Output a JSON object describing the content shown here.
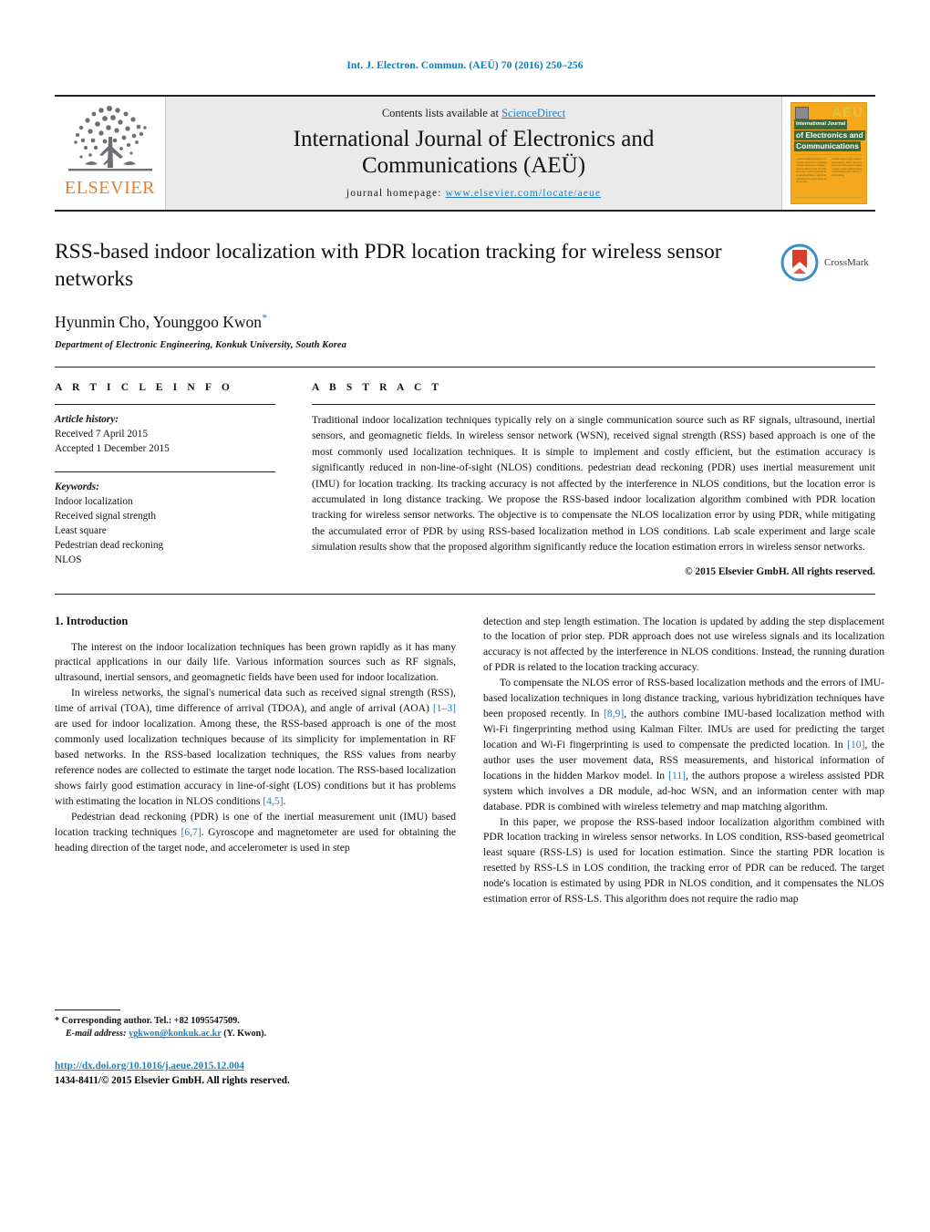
{
  "running_head": "Int. J. Electron. Commun. (AEÜ) 70 (2016) 250–256",
  "masthead": {
    "publisher_name": "ELSEVIER",
    "contents_prefix": "Contents lists available at ",
    "contents_link": "ScienceDirect",
    "journal_title_line1": "International Journal of Electronics and",
    "journal_title_line2": "Communications (AEÜ)",
    "homepage_label": "journal homepage:",
    "homepage_url": "www.elsevier.com/locate/aeue",
    "cover": {
      "badge": "AEU",
      "line0": "International Journal",
      "line1": "of Electronics and",
      "line2": "Communications"
    }
  },
  "article": {
    "title": "RSS-based indoor localization with PDR location tracking for wireless sensor networks",
    "crossmark_label": "CrossMark",
    "authors": "Hyunmin Cho, Younggoo Kwon",
    "author_star": "*",
    "affiliation": "Department of Electronic Engineering, Konkuk University, South Korea"
  },
  "article_info": {
    "heading": "A R T I C L E   I N F O",
    "history_label": "Article history:",
    "history": [
      "Received 7 April 2015",
      "Accepted 1 December 2015"
    ],
    "keywords_label": "Keywords:",
    "keywords": [
      "Indoor localization",
      "Received signal strength",
      "Least square",
      "Pedestrian dead reckoning",
      "NLOS"
    ]
  },
  "abstract": {
    "heading": "A B S T R A C T",
    "text": "Traditional indoor localization techniques typically rely on a single communication source such as RF signals, ultrasound, inertial sensors, and geomagnetic fields. In wireless sensor network (WSN), received signal strength (RSS) based approach is one of the most commonly used localization techniques. It is simple to implement and costly efficient, but the estimation accuracy is significantly reduced in non-line-of-sight (NLOS) conditions. pedestrian dead reckoning (PDR) uses inertial measurement unit (IMU) for location tracking. Its tracking accuracy is not affected by the interference in NLOS conditions, but the location error is accumulated in long distance tracking. We propose the RSS-based indoor localization algorithm combined with PDR location tracking for wireless sensor networks. The objective is to compensate the NLOS localization error by using PDR, while mitigating the accumulated error of PDR by using RSS-based localization method in LOS conditions. Lab scale experiment and large scale simulation results show that the proposed algorithm significantly reduce the location estimation errors in wireless sensor networks.",
    "copyright": "© 2015 Elsevier GmbH. All rights reserved."
  },
  "body": {
    "section_number_title": "1.  Introduction",
    "left_paragraphs": [
      "The interest on the indoor localization techniques has been grown rapidly as it has many practical applications in our daily life. Various information sources such as RF signals, ultrasound, inertial sensors, and geomagnetic fields have been used for indoor localization.",
      "In wireless networks, the signal's numerical data such as received signal strength (RSS), time of arrival (TOA), time difference of arrival (TDOA), and angle of arrival (AOA) [1–3] are used for indoor localization. Among these, the RSS-based approach is one of the most commonly used localization techniques because of its simplicity for implementation in RF based networks. In the RSS-based localization techniques, the RSS values from nearby reference nodes are collected to estimate the target node location. The RSS-based localization shows fairly good estimation accuracy in line-of-sight (LOS) conditions but it has problems with estimating the location in NLOS conditions [4,5].",
      "Pedestrian dead reckoning (PDR) is one of the inertial measurement unit (IMU) based location tracking techniques [6,7]. Gyroscope and magnetometer are used for obtaining the heading direction of the target node, and accelerometer is used in step"
    ],
    "right_paragraphs": [
      "detection and step length estimation. The location is updated by adding the step displacement to the location of prior step. PDR approach does not use wireless signals and its localization accuracy is not affected by the interference in NLOS conditions. Instead, the running duration of PDR is related to the location tracking accuracy.",
      "To compensate the NLOS error of RSS-based localization methods and the errors of IMU-based localization techniques in long distance tracking, various hybridization techniques have been proposed recently. In [8,9], the authors combine IMU-based localization method with Wi-Fi fingerprinting method using Kalman Filter. IMUs are used for predicting the target location and Wi-Fi fingerprinting is used to compensate the predicted location. In [10], the author uses the user movement data, RSS measurements, and historical information of locations in the hidden Markov model. In [11], the authors propose a wireless assisted PDR system which involves a DR module, ad-hoc WSN, and an information center with map database. PDR is combined with wireless telemetry and map matching algorithm.",
      "In this paper, we propose the RSS-based indoor localization algorithm combined with PDR location tracking in wireless sensor networks. In LOS condition, RSS-based geometrical least square (RSS-LS) is used for location estimation. Since the starting PDR location is resetted by RSS-LS in LOS condition, the tracking error of PDR can be reduced. The target node's location is estimated by using PDR in NLOS condition, and it compensates the NLOS estimation error of RSS-LS. This algorithm does not require the radio map"
    ]
  },
  "footnotes": {
    "corresponding_marker": "*",
    "corresponding": "Corresponding author. Tel.: +82 1095547509.",
    "email_label": "E-mail address:",
    "email": "ygkwon@konkuk.ac.kr",
    "email_suffix": "(Y. Kwon).",
    "doi": "http://dx.doi.org/10.1016/j.aeue.2015.12.004",
    "issn_line": "1434-8411/© 2015 Elsevier GmbH. All rights reserved."
  },
  "colors": {
    "link": "#1d7fc0",
    "elsevier_orange": "#f07c22",
    "cover_orange": "#f5a81c",
    "cover_green": "#3a6b3a"
  }
}
